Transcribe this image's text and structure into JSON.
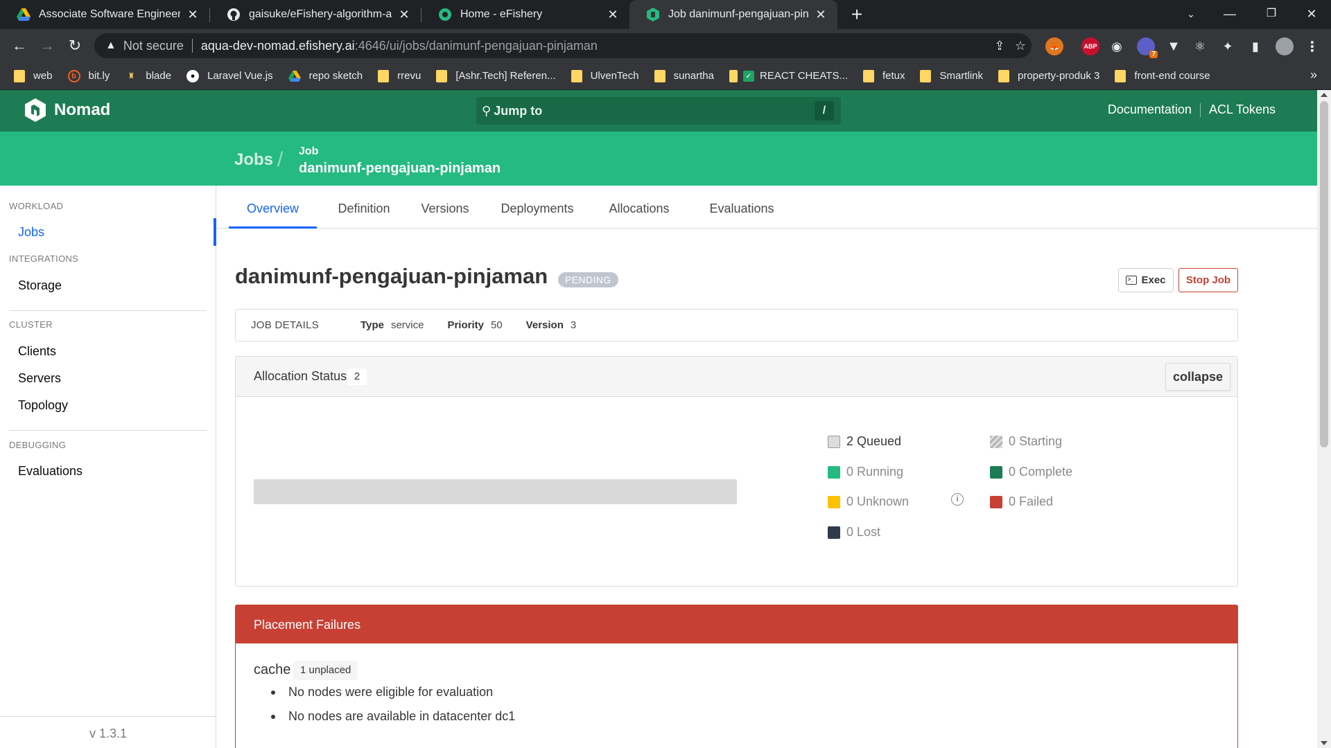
{
  "browser": {
    "tabs": [
      {
        "title": "Associate Software Engineer Asso",
        "icon": "google-drive-icon"
      },
      {
        "title": "gaisuke/eFishery-algorithm-asse",
        "icon": "github-icon"
      },
      {
        "title": "Home - eFishery",
        "icon": "efishery-icon"
      },
      {
        "title": "Job danimunf-pengajuan-pinjam",
        "icon": "nomad-icon",
        "active": true
      }
    ],
    "address": {
      "security": "Not secure",
      "host": "aqua-dev-nomad.efishery.ai",
      "path": ":4646/ui/jobs/danimunf-pengajuan-pinjaman"
    },
    "bookmarks": [
      {
        "label": "web",
        "icon": "folder-icon"
      },
      {
        "label": "bit.ly",
        "icon": "bitly-icon"
      },
      {
        "label": "blade",
        "icon": "blade-icon"
      },
      {
        "label": "Laravel Vue.js",
        "icon": "video-icon"
      },
      {
        "label": "repo sketch",
        "icon": "drive-icon"
      },
      {
        "label": "rrevu",
        "icon": "folder-icon"
      },
      {
        "label": "[Ashr.Tech] Referen...",
        "icon": "folder-icon"
      },
      {
        "label": "UlvenTech",
        "icon": "folder-icon"
      },
      {
        "label": "sunartha",
        "icon": "folder-icon"
      },
      {
        "label": "REACT CHEATS...",
        "icon": "check-icon"
      },
      {
        "label": "fetux",
        "icon": "folder-icon"
      },
      {
        "label": "Smartlink",
        "icon": "folder-icon"
      },
      {
        "label": "property-produk 3",
        "icon": "folder-icon"
      },
      {
        "label": "front-end course",
        "icon": "folder-icon"
      }
    ],
    "ext_badge": "7"
  },
  "nomad": {
    "brand": "Nomad",
    "search_placeholder": "Jump to",
    "search_shortcut": "/",
    "links": {
      "documentation": "Documentation",
      "acl": "ACL Tokens"
    },
    "breadcrumb": {
      "jobs": "Jobs",
      "job_label": "Job",
      "job_name": "danimunf-pengajuan-pinjaman"
    }
  },
  "sidebar": {
    "workload_label": "WORKLOAD",
    "jobs": "Jobs",
    "integrations_label": "INTEGRATIONS",
    "storage": "Storage",
    "cluster_label": "CLUSTER",
    "clients": "Clients",
    "servers": "Servers",
    "topology": "Topology",
    "debugging_label": "DEBUGGING",
    "evaluations": "Evaluations",
    "version": "v 1.3.1"
  },
  "tabs": [
    "Overview",
    "Definition",
    "Versions",
    "Deployments",
    "Allocations",
    "Evaluations"
  ],
  "job": {
    "name": "danimunf-pengajuan-pinjaman",
    "status": "PENDING",
    "exec_label": "Exec",
    "stop_label": "Stop Job",
    "details": {
      "header": "JOB DETAILS",
      "type_label": "Type",
      "type": "service",
      "priority_label": "Priority",
      "priority": "50",
      "version_label": "Version",
      "version": "3"
    }
  },
  "allocation_status": {
    "title": "Allocation Status",
    "count": "2",
    "collapse": "collapse",
    "queued_fraction": 1.0,
    "legend": {
      "queued": "2 Queued",
      "starting": "0 Starting",
      "running": "0 Running",
      "complete": "0 Complete",
      "unknown": "0 Unknown",
      "failed": "0 Failed",
      "lost": "0 Lost"
    },
    "colors": {
      "queued": "#d9d9d9",
      "running": "#25ba81",
      "complete": "#1d7c53",
      "unknown": "#fcc200",
      "failed": "#c84034",
      "lost": "#2f3b4c"
    }
  },
  "placement_failures": {
    "title": "Placement Failures",
    "group": "cache",
    "tag": "1 unplaced",
    "reasons": [
      "No nodes were eligible for evaluation",
      "No nodes are available in datacenter dc1"
    ]
  }
}
